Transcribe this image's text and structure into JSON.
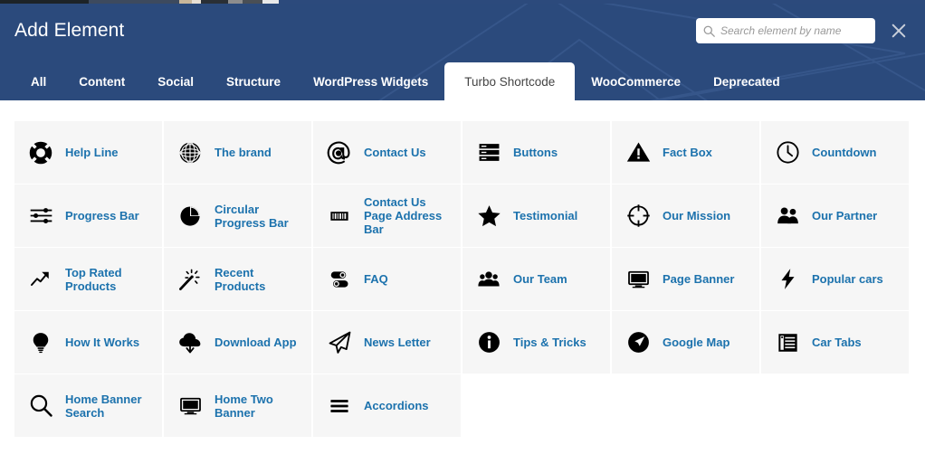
{
  "header": {
    "title": "Add Element",
    "close_label": "×",
    "close_icon": "close-icon",
    "accent_color": "#2b4a7c",
    "link_color": "#1c72ad"
  },
  "search": {
    "placeholder": "Search element by name",
    "value": "",
    "icon": "search-icon"
  },
  "tabs": [
    {
      "label": "All",
      "active": false
    },
    {
      "label": "Content",
      "active": false
    },
    {
      "label": "Social",
      "active": false
    },
    {
      "label": "Structure",
      "active": false
    },
    {
      "label": "WordPress Widgets",
      "active": false
    },
    {
      "label": "Turbo Shortcode",
      "active": true
    },
    {
      "label": "WooCommerce",
      "active": false
    },
    {
      "label": "Deprecated",
      "active": false
    }
  ],
  "elements": [
    {
      "label": "Help Line",
      "icon": "lifebuoy-icon"
    },
    {
      "label": "The brand",
      "icon": "globe-icon"
    },
    {
      "label": "Contact Us",
      "icon": "at-sign-icon"
    },
    {
      "label": "Buttons",
      "icon": "server-bars-icon"
    },
    {
      "label": "Fact Box",
      "icon": "warning-triangle-icon"
    },
    {
      "label": "Countdown",
      "icon": "clock-icon"
    },
    {
      "label": "Progress Bar",
      "icon": "sliders-icon"
    },
    {
      "label": "Circular Progress Bar",
      "icon": "pie-chart-icon"
    },
    {
      "label": "Contact Us Page Address Bar",
      "icon": "barcode-icon"
    },
    {
      "label": "Testimonial",
      "icon": "star-icon"
    },
    {
      "label": "Our Mission",
      "icon": "crosshair-icon"
    },
    {
      "label": "Our Partner",
      "icon": "two-users-icon"
    },
    {
      "label": "Top Rated Products",
      "icon": "trend-arrow-icon"
    },
    {
      "label": "Recent Products",
      "icon": "magic-wand-icon"
    },
    {
      "label": "FAQ",
      "icon": "toggles-icon"
    },
    {
      "label": "Our Team",
      "icon": "three-users-icon"
    },
    {
      "label": "Page Banner",
      "icon": "desktop-monitor-icon"
    },
    {
      "label": "Popular cars",
      "icon": "lightning-bolt-icon"
    },
    {
      "label": "How It Works",
      "icon": "lightbulb-icon"
    },
    {
      "label": "Download App",
      "icon": "cloud-download-icon"
    },
    {
      "label": "News Letter",
      "icon": "paper-plane-icon"
    },
    {
      "label": "Tips & Tricks",
      "icon": "info-circle-icon"
    },
    {
      "label": "Google Map",
      "icon": "location-arrow-icon"
    },
    {
      "label": "Car Tabs",
      "icon": "document-tabs-icon"
    },
    {
      "label": "Home Banner Search",
      "icon": "magnifier-icon"
    },
    {
      "label": "Home Two Banner",
      "icon": "desktop-monitor-icon"
    },
    {
      "label": "Accordions",
      "icon": "hamburger-lines-icon"
    }
  ]
}
